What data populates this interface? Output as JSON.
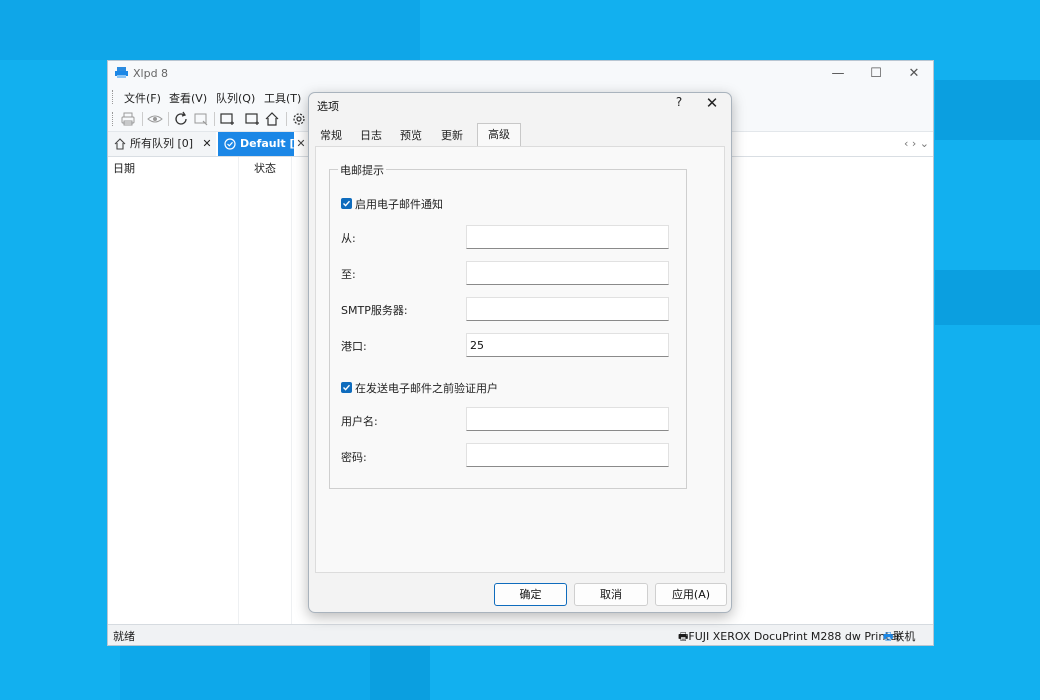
{
  "app": {
    "title": "Xlpd 8",
    "window_controls": [
      "—",
      "☐",
      "✕"
    ]
  },
  "menu": {
    "items": [
      "文件(F)",
      "查看(V)",
      "队列(Q)",
      "工具(T)"
    ]
  },
  "toolbar": {
    "icons": [
      "printer-icon",
      "eye-icon",
      "refresh-icon",
      "window-select-icon",
      "add-window-icon",
      "add-queue-icon",
      "home-icon",
      "gear-icon"
    ]
  },
  "tabs": {
    "all_queues": "所有队列 [0]",
    "default": "Default [0]",
    "close": "✕",
    "nav": "‹  ›  ⌄"
  },
  "grid": {
    "columns": [
      "日期",
      "状态"
    ]
  },
  "status": {
    "left": "就绪",
    "printer": "FUJI XEROX DocuPrint M288 dw Printer",
    "online": "联机"
  },
  "dialog": {
    "title": "选项",
    "help": "?",
    "close": "✕",
    "tabs": [
      "常规",
      "日志",
      "预览",
      "更新",
      "高级"
    ],
    "active_tab": "高级",
    "group_title": "电邮提示",
    "enable_email": {
      "label": "启用电子邮件通知",
      "checked": true
    },
    "fields": {
      "from": {
        "label": "从:",
        "value": ""
      },
      "to": {
        "label": "至:",
        "value": ""
      },
      "smtp": {
        "label": "SMTP服务器:",
        "value": ""
      },
      "port": {
        "label": "港口:",
        "value": "25"
      }
    },
    "auth": {
      "label": "在发送电子邮件之前验证用户",
      "checked": true
    },
    "auth_fields": {
      "username": {
        "label": "用户名:",
        "value": ""
      },
      "password": {
        "label": "密码:",
        "value": ""
      }
    },
    "buttons": {
      "ok": "确定",
      "cancel": "取消",
      "apply": "应用(A)"
    }
  },
  "colors": {
    "desktop": "#12b0ef",
    "accent": "#1b87e6",
    "checkbox": "#0f6cbd"
  }
}
